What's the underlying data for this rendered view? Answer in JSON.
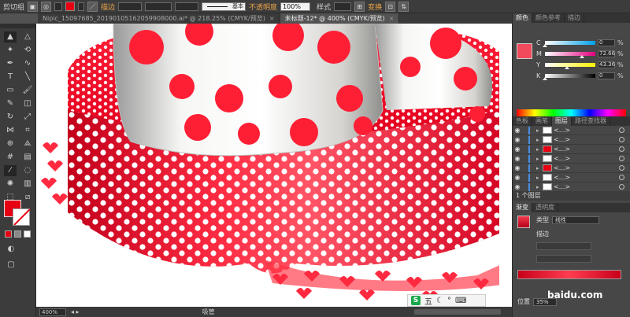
{
  "control_bar": {
    "tool_name": "剪切组",
    "stroke_label": "描边",
    "stroke_style": "基本",
    "opacity_label": "不透明度",
    "opacity_value": "100%",
    "style_label": "样式",
    "transform_label": "变换"
  },
  "document_tabs": [
    {
      "label": "Nipic_15097685_20190105162059908000.ai* @ 218.25% (CMYK/预览)",
      "active": false
    },
    {
      "label": "未标题-12* @ 400% (CMYK/预览)",
      "active": true
    }
  ],
  "color_panel": {
    "tabs": [
      "颜色",
      "颜色参考",
      "描边"
    ],
    "channels": [
      {
        "label": "C",
        "value": "0",
        "level": 0.0
      },
      {
        "label": "M",
        "value": "72.66",
        "level": 0.73
      },
      {
        "label": "Y",
        "value": "43.36",
        "level": 0.43
      },
      {
        "label": "K",
        "value": "0",
        "level": 0.0
      }
    ],
    "fill_color": "#f04a5c"
  },
  "layers_panel": {
    "tabs": [
      "色板",
      "画笔",
      "图层",
      "路径查找器"
    ],
    "rows": [
      {
        "name": "<...>"
      },
      {
        "name": "<...>"
      },
      {
        "name": "<...>"
      },
      {
        "name": "<...>"
      },
      {
        "name": "<...>"
      },
      {
        "name": "<...>"
      },
      {
        "name": "<...>"
      }
    ],
    "footer": "1 个图层"
  },
  "gradient_panel": {
    "tabs": [
      "渐变",
      "透明度"
    ],
    "type_label": "类型",
    "type_value": "线性",
    "stroke_label": "描边",
    "position_label": "位置",
    "position_value": "35%"
  },
  "status_bar": {
    "zoom": "400%",
    "tool": "吸管"
  },
  "ime": {
    "brand": "S",
    "label": "五"
  },
  "watermark": "baidu.com",
  "colors": {
    "accent_red": "#e60012",
    "polka_dot": "#ffffff",
    "canvas": "#ffffff"
  }
}
